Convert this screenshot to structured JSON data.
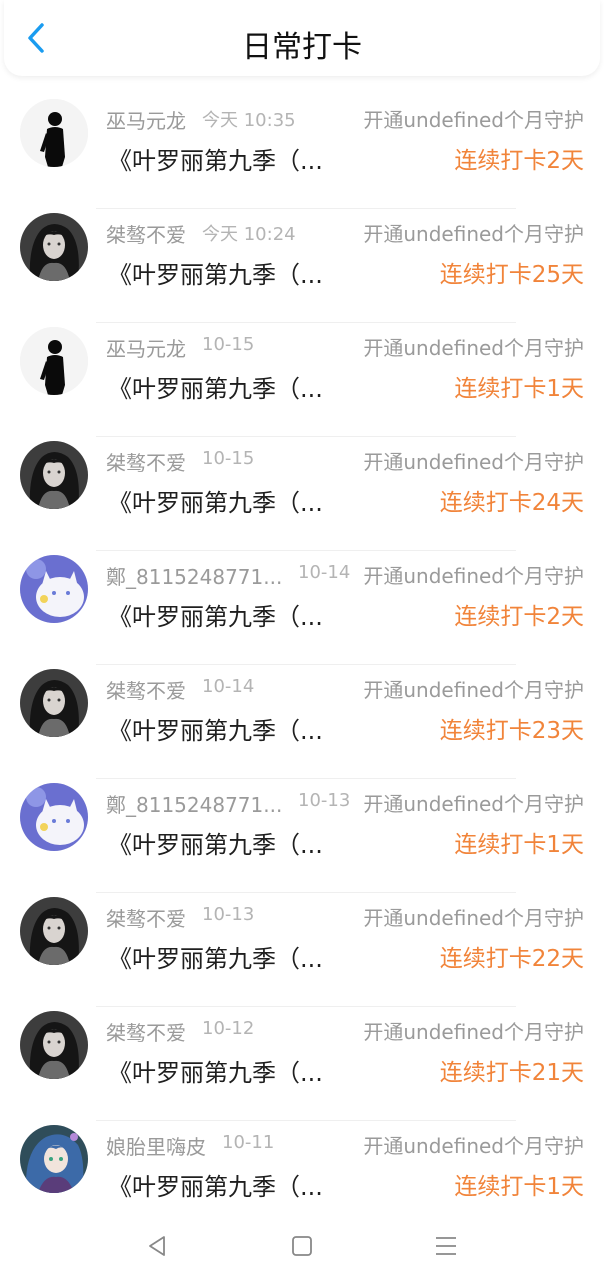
{
  "header": {
    "title": "日常打卡",
    "back_icon": "chevron-left-icon",
    "accent_color": "#1a9cf0"
  },
  "colors": {
    "streak": "#f1843a",
    "meta": "#9a9a9a"
  },
  "rows": [
    {
      "name": "巫马元龙",
      "time": "今天 10:35",
      "tag": "开通undefined个月守护",
      "book": "《叶罗丽第九季（...",
      "streak": "连续打卡2天",
      "avatar": "silhouette"
    },
    {
      "name": "桀骜不爱",
      "time": "今天 10:24",
      "tag": "开通undefined个月守护",
      "book": "《叶罗丽第九季（...",
      "streak": "连续打卡25天",
      "avatar": "dark-girl"
    },
    {
      "name": "巫马元龙",
      "time": "10-15",
      "tag": "开通undefined个月守护",
      "book": "《叶罗丽第九季（...",
      "streak": "连续打卡1天",
      "avatar": "silhouette"
    },
    {
      "name": "桀骜不爱",
      "time": "10-15",
      "tag": "开通undefined个月守护",
      "book": "《叶罗丽第九季（...",
      "streak": "连续打卡24天",
      "avatar": "dark-girl"
    },
    {
      "name": "鄭_8115248771...",
      "time": "10-14",
      "tag": "开通undefined个月守护",
      "book": "《叶罗丽第九季（...",
      "streak": "连续打卡2天",
      "avatar": "white-cat"
    },
    {
      "name": "桀骜不爱",
      "time": "10-14",
      "tag": "开通undefined个月守护",
      "book": "《叶罗丽第九季（...",
      "streak": "连续打卡23天",
      "avatar": "dark-girl"
    },
    {
      "name": "鄭_8115248771...",
      "time": "10-13",
      "tag": "开通undefined个月守护",
      "book": "《叶罗丽第九季（...",
      "streak": "连续打卡1天",
      "avatar": "white-cat"
    },
    {
      "name": "桀骜不爱",
      "time": "10-13",
      "tag": "开通undefined个月守护",
      "book": "《叶罗丽第九季（...",
      "streak": "连续打卡22天",
      "avatar": "dark-girl"
    },
    {
      "name": "桀骜不爱",
      "time": "10-12",
      "tag": "开通undefined个月守护",
      "book": "《叶罗丽第九季（...",
      "streak": "连续打卡21天",
      "avatar": "dark-girl"
    },
    {
      "name": "娘胎里嗨皮",
      "time": "10-11",
      "tag": "开通undefined个月守护",
      "book": "《叶罗丽第九季（...",
      "streak": "连续打卡1天",
      "avatar": "anime-girl"
    }
  ],
  "navbar": {
    "back_icon": "triangle-back-icon",
    "home_icon": "square-home-icon",
    "menu_icon": "three-line-menu-icon"
  }
}
